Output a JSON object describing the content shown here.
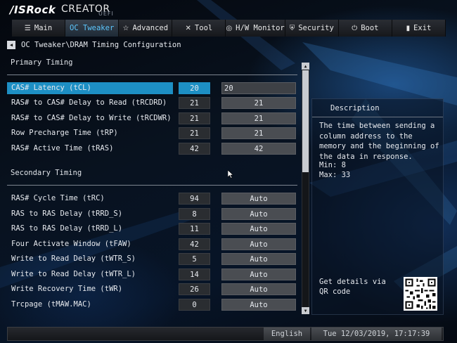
{
  "brand": {
    "logo": "/ISRock",
    "product": "CREATOR",
    "firmware": "UEFI"
  },
  "tabs": [
    {
      "label": "Main",
      "icon": "list-icon"
    },
    {
      "label": "OC Tweaker",
      "icon": "oc-icon",
      "active": true
    },
    {
      "label": "Advanced",
      "icon": "star-icon"
    },
    {
      "label": "Tool",
      "icon": "tools-icon"
    },
    {
      "label": "H/W Monitor",
      "icon": "monitor-icon"
    },
    {
      "label": "Security",
      "icon": "shield-icon"
    },
    {
      "label": "Boot",
      "icon": "power-icon"
    },
    {
      "label": "Exit",
      "icon": "exit-icon"
    }
  ],
  "breadcrumb": "OC Tweaker\\DRAM Timing Configuration",
  "primary": {
    "title": "Primary Timing",
    "rows": [
      {
        "label": "CAS# Latency (tCL)",
        "value": "20",
        "field": "20",
        "selected": true
      },
      {
        "label": "RAS# to CAS# Delay to Read  (tRCDRD)",
        "value": "21",
        "field": "21"
      },
      {
        "label": "RAS# to CAS# Delay to Write (tRCDWR)",
        "value": "21",
        "field": "21"
      },
      {
        "label": "Row Precharge Time (tRP)",
        "value": "21",
        "field": "21"
      },
      {
        "label": "RAS# Active Time (tRAS)",
        "value": "42",
        "field": "42"
      }
    ]
  },
  "secondary": {
    "title": "Secondary Timing",
    "rows": [
      {
        "label": "RAS# Cycle Time (tRC)",
        "value": "94",
        "field": "Auto"
      },
      {
        "label": "RAS to RAS Delay (tRRD_S)",
        "value": "8",
        "field": "Auto"
      },
      {
        "label": "RAS to RAS Delay (tRRD_L)",
        "value": "11",
        "field": "Auto"
      },
      {
        "label": "Four Activate Window (tFAW)",
        "value": "42",
        "field": "Auto"
      },
      {
        "label": "Write to Read Delay (tWTR_S)",
        "value": "5",
        "field": "Auto"
      },
      {
        "label": "Write to Read Delay (tWTR_L)",
        "value": "14",
        "field": "Auto"
      },
      {
        "label": "Write Recovery Time (tWR)",
        "value": "26",
        "field": "Auto"
      },
      {
        "label": "Trcpage (tMAW.MAC)",
        "value": "0",
        "field": "Auto"
      }
    ]
  },
  "description": {
    "title": "Description",
    "body": "The time between sending a column address to the memory and the beginning of the data in response.",
    "min": "Min: 8",
    "max": "Max: 33",
    "qr_text": "Get details via QR code"
  },
  "footer": {
    "language": "English",
    "datetime": "Tue 12/03/2019, 17:17:39"
  }
}
